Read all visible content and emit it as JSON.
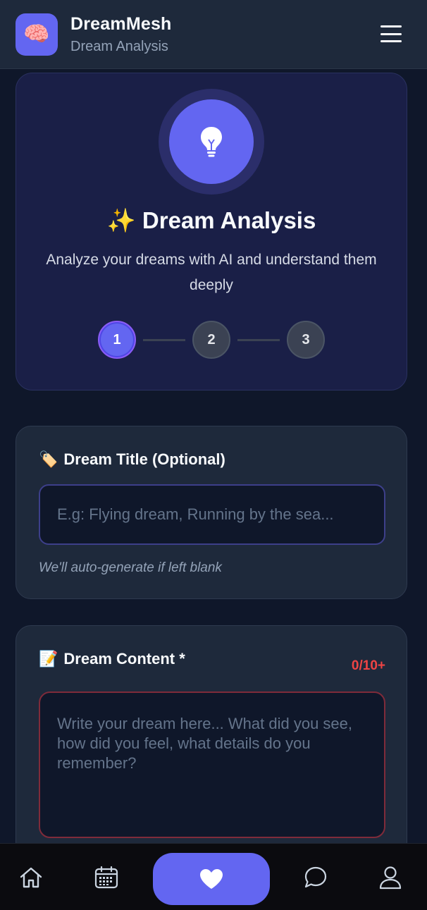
{
  "header": {
    "app_name": "DreamMesh",
    "subtitle": "Dream Analysis",
    "logo_emoji": "🧠"
  },
  "hero": {
    "title": "✨ Dream Analysis",
    "description": "Analyze your dreams with AI and understand them deeply",
    "icon": "lightbulb-icon",
    "steps": [
      {
        "label": "1",
        "active": true
      },
      {
        "label": "2",
        "active": false
      },
      {
        "label": "3",
        "active": false
      }
    ]
  },
  "dream_title": {
    "emoji": "🏷️",
    "label": "Dream Title (Optional)",
    "value": "",
    "placeholder": "E.g: Flying dream, Running by the sea...",
    "hint": "We'll auto-generate if left blank"
  },
  "dream_content": {
    "emoji": "📝",
    "label": "Dream Content *",
    "counter": "0/10+",
    "value": "",
    "placeholder": "Write your dream here... What did you see, how did you feel, what details do you remember?"
  },
  "bottom_nav": {
    "items": [
      "home-icon",
      "calendar-icon",
      "heart-icon",
      "chat-icon",
      "profile-icon"
    ]
  },
  "colors": {
    "accent": "#6366f1",
    "background": "#0f172a",
    "card": "#1e293b",
    "error": "#ef4444"
  }
}
